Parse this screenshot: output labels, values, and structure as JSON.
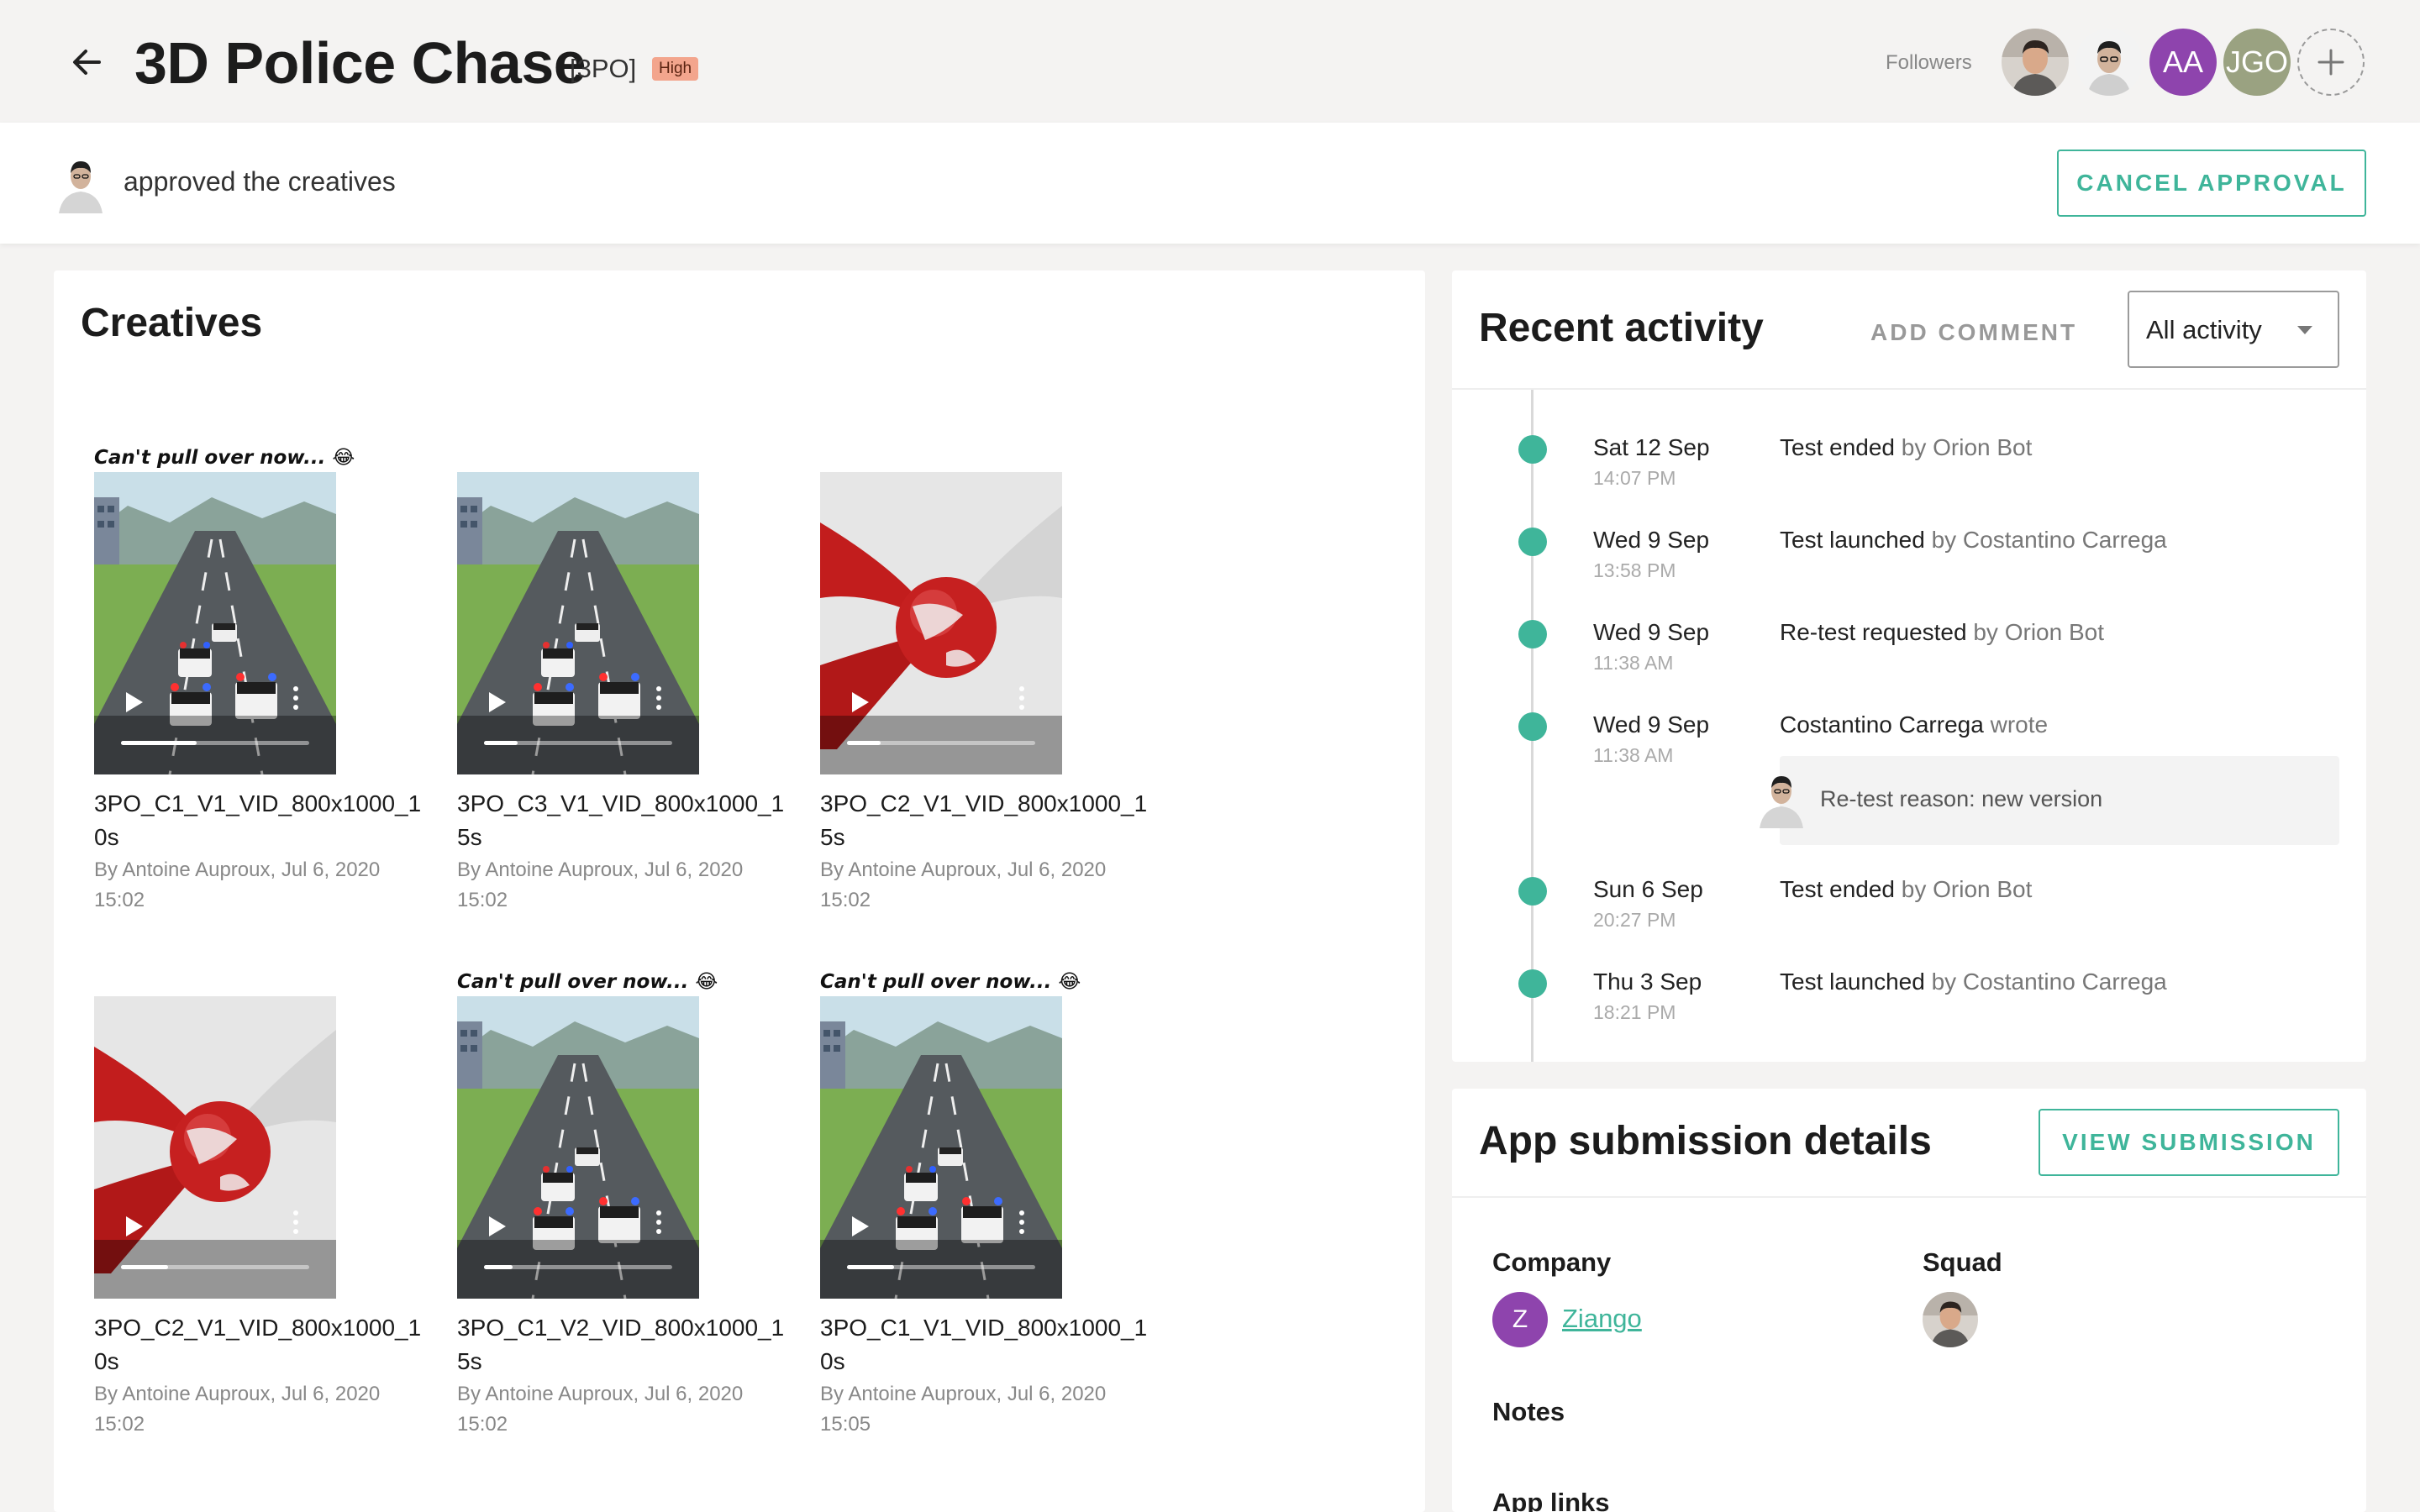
{
  "header": {
    "title": "3D Police Chase",
    "code": "[3PO]",
    "priority": "High",
    "followers_label": "Followers",
    "followers": [
      {
        "type": "photo",
        "name": "follower-photo-1"
      },
      {
        "type": "photo",
        "name": "follower-photo-2"
      },
      {
        "type": "initials",
        "initials": "AA",
        "color": "#8e44ad"
      },
      {
        "type": "initials",
        "initials": "JGO",
        "color": "#9aa281"
      }
    ]
  },
  "approval": {
    "text": "approved the creatives",
    "cancel_label": "CANCEL APPROVAL"
  },
  "creatives": {
    "title": "Creatives",
    "items": [
      {
        "name": "3PO_C1_V1_VID_800x1000_10s",
        "meta": "By Antoine Auproux, Jul 6, 2020 15:02",
        "thumb": "road",
        "caption": "Can't pull over now... 😂",
        "progress": 0.4
      },
      {
        "name": "3PO_C3_V1_VID_800x1000_15s",
        "meta": "By Antoine Auproux, Jul 6, 2020 15:02",
        "thumb": "road",
        "caption": "",
        "progress": 0.18
      },
      {
        "name": "3PO_C2_V1_VID_800x1000_15s",
        "meta": "By Antoine Auproux, Jul 6, 2020 15:02",
        "thumb": "globe",
        "caption": "",
        "progress": 0.18
      },
      {
        "name": "3PO_C2_V1_VID_800x1000_10s",
        "meta": "By Antoine Auproux, Jul 6, 2020 15:02",
        "thumb": "globe",
        "caption": "",
        "progress": 0.25
      },
      {
        "name": "3PO_C1_V2_VID_800x1000_15s",
        "meta": "By Antoine Auproux, Jul 6, 2020 15:02",
        "thumb": "road",
        "caption": "Can't pull over now... 😂",
        "progress": 0.15
      },
      {
        "name": "3PO_C1_V1_VID_800x1000_10s",
        "meta": "By Antoine Auproux, Jul 6, 2020 15:05",
        "thumb": "road",
        "caption": "Can't pull over now... 😂",
        "progress": 0.25
      }
    ]
  },
  "activity": {
    "title": "Recent activity",
    "add_comment_label": "ADD COMMENT",
    "filter_value": "All activity",
    "entries": [
      {
        "date": "Sat 12 Sep",
        "time": "14:07 PM",
        "action": "Test ended",
        "by": " by Orion Bot"
      },
      {
        "date": "Wed 9 Sep",
        "time": "13:58 PM",
        "action": "Test launched",
        "by": " by Costantino Carrega"
      },
      {
        "date": "Wed 9 Sep",
        "time": "11:38 AM",
        "action": "Re-test requested",
        "by": " by Orion Bot"
      },
      {
        "date": "Wed 9 Sep",
        "time": "11:38 AM",
        "action": "Costantino Carrega",
        "by": " wrote"
      },
      {
        "date": "Sun 6 Sep",
        "time": "20:27 PM",
        "action": "Test ended",
        "by": " by Orion Bot"
      },
      {
        "date": "Thu 3 Sep",
        "time": "18:21 PM",
        "action": "Test launched",
        "by": " by Costantino Carrega"
      }
    ],
    "comment_text": "Re-test reason: new version"
  },
  "submission": {
    "title": "App submission details",
    "view_label": "VIEW SUBMISSION",
    "company_label": "Company",
    "company_initial": "Z",
    "company_name": "Ziango",
    "squad_label": "Squad",
    "notes_label": "Notes",
    "cut_label": "App links"
  },
  "colors": {
    "accent": "#3fb59a",
    "priority_bg": "#f3a58d"
  }
}
